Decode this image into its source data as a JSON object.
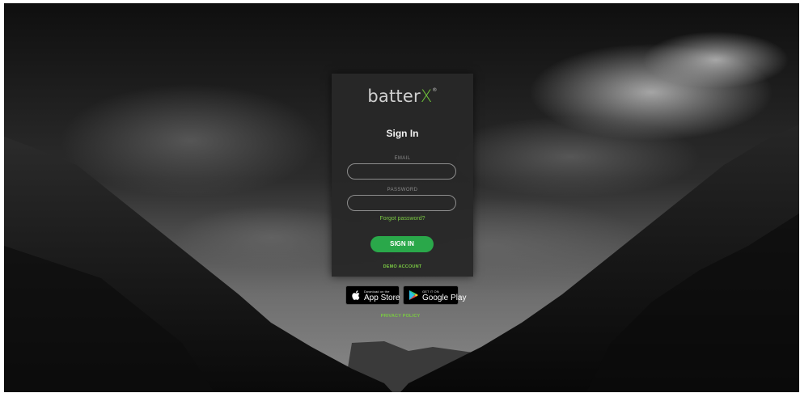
{
  "brand": {
    "logo_text": "batter",
    "logo_accent": "X",
    "registered": "®"
  },
  "login": {
    "title": "Sign In",
    "email_label": "EMAIL",
    "email_value": "",
    "password_label": "PASSWORD",
    "password_value": "",
    "forgot_link": "Forgot password?",
    "submit_label": "SIGN IN",
    "demo_link": "DEMO ACCOUNT"
  },
  "stores": {
    "apple": {
      "small": "Download on the",
      "big": "App Store"
    },
    "google": {
      "small": "GET IT ON",
      "big": "Google Play"
    }
  },
  "footer": {
    "privacy_link": "PRIVACY POLICY"
  },
  "colors": {
    "accent": "#7ac943",
    "button": "#2aa84a",
    "card": "#282828"
  },
  "icons": [
    "apple-icon",
    "google-play-icon"
  ]
}
